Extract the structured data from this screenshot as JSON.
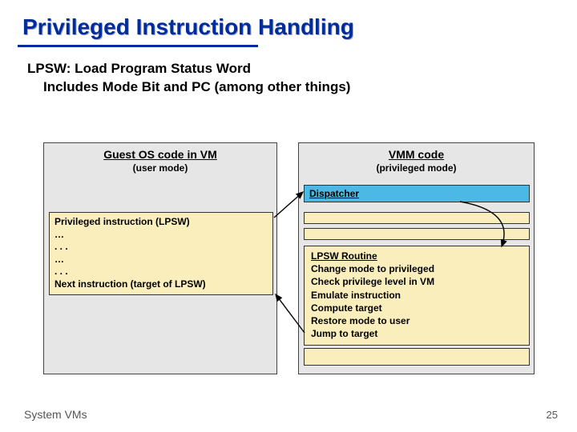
{
  "title": "Privileged Instruction Handling",
  "subtitle_l1": "LPSW: Load Program Status Word",
  "subtitle_l2": "Includes Mode Bit and PC (among other things)",
  "left": {
    "heading": "Guest OS code in VM",
    "sub": "(user mode)",
    "code_l1": "Privileged instruction (LPSW)",
    "code_l2": "…",
    "code_l3": ". . .",
    "code_l4": "…",
    "code_l5": ". . .",
    "code_l6": "Next instruction (target of LPSW)"
  },
  "right": {
    "heading": "VMM code",
    "sub": "(privileged mode)",
    "dispatcher": "Dispatcher",
    "routine_hd": "LPSW Routine",
    "routine_l1": "Change mode to privileged",
    "routine_l2": "Check privilege level in VM",
    "routine_l3": "Emulate instruction",
    "routine_l4": "Compute target",
    "routine_l5": "Restore mode to user",
    "routine_l6": "Jump to target"
  },
  "footer": "System VMs",
  "page": "25"
}
